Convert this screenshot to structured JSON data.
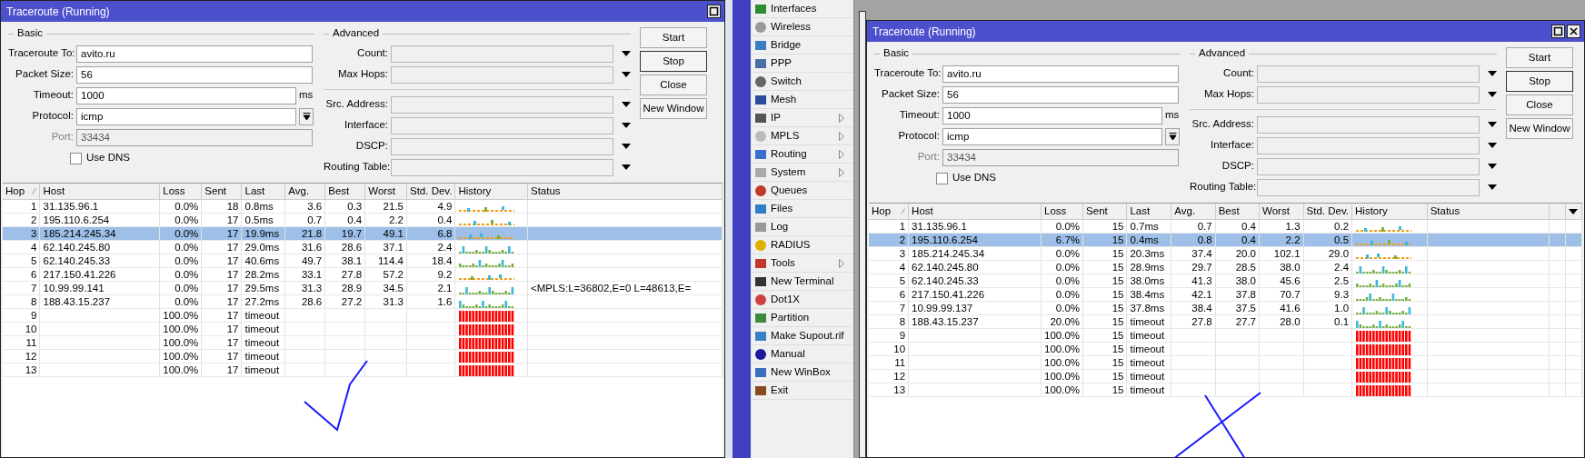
{
  "windows": [
    {
      "title": "Traceroute (Running)",
      "close_button": false,
      "basic_legend": "Basic",
      "advanced_legend": "Advanced",
      "check_mark": true,
      "cross_mark": false,
      "column_menu": false,
      "fields": [
        {
          "label": "Traceroute To:",
          "value": "avito.ru",
          "kind": "text",
          "disabled": false
        },
        {
          "label": "Packet Size:",
          "value": "56",
          "kind": "text",
          "disabled": false
        },
        {
          "label": "Timeout:",
          "value": "1000",
          "unit": "ms",
          "kind": "text",
          "disabled": false
        },
        {
          "label": "Protocol:",
          "value": "icmp",
          "kind": "select",
          "disabled": false
        },
        {
          "label": "Port:",
          "value": "33434",
          "kind": "text",
          "disabled": true
        }
      ],
      "use_dns": {
        "label": "Use DNS",
        "checked": false
      },
      "advanced_fields": [
        {
          "label": "Count:",
          "separator_before": false
        },
        {
          "label": "Max Hops:",
          "separator_before": false
        },
        {
          "label": "Src. Address:",
          "separator_before": true
        },
        {
          "label": "Interface:",
          "separator_before": false
        },
        {
          "label": "DSCP:",
          "separator_before": false
        },
        {
          "label": "Routing Table:",
          "separator_before": false
        }
      ],
      "buttons": [
        {
          "label": "Start",
          "focused": false
        },
        {
          "label": "Stop",
          "focused": true
        },
        {
          "label": "Close",
          "focused": false
        },
        {
          "label": "New Window",
          "focused": false
        }
      ],
      "columns": [
        "Hop",
        "Host",
        "Loss",
        "Sent",
        "Last",
        "Avg.",
        "Best",
        "Worst",
        "Std. Dev.",
        "History",
        "Status"
      ],
      "rows": [
        {
          "hop": "1",
          "host": "31.135.96.1",
          "loss": "0.0%",
          "sent": "18",
          "last": "0.8ms",
          "avg": "3.6",
          "best": "0.3",
          "worst": "21.5",
          "std_dev": "4.9",
          "kind": "dashed",
          "selected": false
        },
        {
          "hop": "2",
          "host": "195.110.6.254",
          "loss": "0.0%",
          "sent": "17",
          "last": "0.5ms",
          "avg": "0.7",
          "best": "0.4",
          "worst": "2.2",
          "std_dev": "0.4",
          "kind": "dashed",
          "selected": false
        },
        {
          "hop": "3",
          "host": "185.214.245.34",
          "loss": "0.0%",
          "sent": "17",
          "last": "19.9ms",
          "avg": "21.8",
          "best": "19.7",
          "worst": "49.1",
          "std_dev": "6.8",
          "kind": "dashed",
          "selected": true
        },
        {
          "hop": "4",
          "host": "62.140.245.80",
          "loss": "0.0%",
          "sent": "17",
          "last": "29.0ms",
          "avg": "31.6",
          "best": "28.6",
          "worst": "37.1",
          "std_dev": "2.4",
          "kind": "bars",
          "selected": false
        },
        {
          "hop": "5",
          "host": "62.140.245.33",
          "loss": "0.0%",
          "sent": "17",
          "last": "40.6ms",
          "avg": "49.7",
          "best": "38.1",
          "worst": "114.4",
          "std_dev": "18.4",
          "kind": "bars",
          "selected": false
        },
        {
          "hop": "6",
          "host": "217.150.41.226",
          "loss": "0.0%",
          "sent": "17",
          "last": "28.2ms",
          "avg": "33.1",
          "best": "27.8",
          "worst": "57.2",
          "std_dev": "9.2",
          "kind": "dashed",
          "selected": false
        },
        {
          "hop": "7",
          "host": "10.99.99.141",
          "loss": "0.0%",
          "sent": "17",
          "last": "29.5ms",
          "avg": "31.3",
          "best": "28.9",
          "worst": "34.5",
          "std_dev": "2.1",
          "kind": "bars",
          "status": "<MPLS:L=36802,E=0 L=48613,E=",
          "selected": false
        },
        {
          "hop": "8",
          "host": "188.43.15.237",
          "loss": "0.0%",
          "sent": "17",
          "last": "27.2ms",
          "avg": "28.6",
          "best": "27.2",
          "worst": "31.3",
          "std_dev": "1.6",
          "kind": "bars",
          "selected": false
        },
        {
          "hop": "9",
          "loss": "100.0%",
          "sent": "17",
          "last": "timeout",
          "kind": "lost",
          "selected": false
        },
        {
          "hop": "10",
          "loss": "100.0%",
          "sent": "17",
          "last": "timeout",
          "kind": "lost",
          "selected": false
        },
        {
          "hop": "11",
          "loss": "100.0%",
          "sent": "17",
          "last": "timeout",
          "kind": "lost",
          "selected": false
        },
        {
          "hop": "12",
          "loss": "100.0%",
          "sent": "17",
          "last": "timeout",
          "kind": "lost",
          "selected": false
        },
        {
          "hop": "13",
          "loss": "100.0%",
          "sent": "17",
          "last": "timeout",
          "kind": "lost",
          "selected": false
        }
      ]
    },
    {
      "title": "Traceroute (Running)",
      "close_button": true,
      "basic_legend": "Basic",
      "advanced_legend": "Advanced",
      "check_mark": false,
      "cross_mark": true,
      "column_menu": true,
      "fields": [
        {
          "label": "Traceroute To:",
          "value": "avito.ru",
          "kind": "text",
          "disabled": false
        },
        {
          "label": "Packet Size:",
          "value": "56",
          "kind": "text",
          "disabled": false
        },
        {
          "label": "Timeout:",
          "value": "1000",
          "unit": "ms",
          "kind": "text",
          "disabled": false
        },
        {
          "label": "Protocol:",
          "value": "icmp",
          "kind": "select",
          "disabled": false
        },
        {
          "label": "Port:",
          "value": "33434",
          "kind": "text",
          "disabled": true
        }
      ],
      "use_dns": {
        "label": "Use DNS",
        "checked": false
      },
      "advanced_fields": [
        {
          "label": "Count:",
          "separator_before": false
        },
        {
          "label": "Max Hops:",
          "separator_before": false
        },
        {
          "label": "Src. Address:",
          "separator_before": true
        },
        {
          "label": "Interface:",
          "separator_before": false
        },
        {
          "label": "DSCP:",
          "separator_before": false
        },
        {
          "label": "Routing Table:",
          "separator_before": false
        }
      ],
      "buttons": [
        {
          "label": "Start",
          "focused": false
        },
        {
          "label": "Stop",
          "focused": true
        },
        {
          "label": "Close",
          "focused": false
        },
        {
          "label": "New Window",
          "focused": false
        }
      ],
      "columns": [
        "Hop",
        "Host",
        "Loss",
        "Sent",
        "Last",
        "Avg.",
        "Best",
        "Worst",
        "Std. Dev.",
        "History",
        "Status"
      ],
      "rows": [
        {
          "hop": "1",
          "host": "31.135.96.1",
          "loss": "0.0%",
          "sent": "15",
          "last": "0.7ms",
          "avg": "0.7",
          "best": "0.4",
          "worst": "1.3",
          "std_dev": "0.2",
          "kind": "dashed",
          "selected": false
        },
        {
          "hop": "2",
          "host": "195.110.6.254",
          "loss": "6.7%",
          "sent": "15",
          "last": "0.4ms",
          "avg": "0.8",
          "best": "0.4",
          "worst": "2.2",
          "std_dev": "0.5",
          "kind": "dashed",
          "selected": true
        },
        {
          "hop": "3",
          "host": "185.214.245.34",
          "loss": "0.0%",
          "sent": "15",
          "last": "20.3ms",
          "avg": "37.4",
          "best": "20.0",
          "worst": "102.1",
          "std_dev": "29.0",
          "kind": "dashed",
          "selected": false
        },
        {
          "hop": "4",
          "host": "62.140.245.80",
          "loss": "0.0%",
          "sent": "15",
          "last": "28.9ms",
          "avg": "29.7",
          "best": "28.5",
          "worst": "38.0",
          "std_dev": "2.4",
          "kind": "bars",
          "selected": false
        },
        {
          "hop": "5",
          "host": "62.140.245.33",
          "loss": "0.0%",
          "sent": "15",
          "last": "38.0ms",
          "avg": "41.3",
          "best": "38.0",
          "worst": "45.6",
          "std_dev": "2.5",
          "kind": "bars",
          "selected": false
        },
        {
          "hop": "6",
          "host": "217.150.41.226",
          "loss": "0.0%",
          "sent": "15",
          "last": "38.4ms",
          "avg": "42.1",
          "best": "37.8",
          "worst": "70.7",
          "std_dev": "9.3",
          "kind": "bars",
          "selected": false
        },
        {
          "hop": "7",
          "host": "10.99.99.137",
          "loss": "0.0%",
          "sent": "15",
          "last": "37.8ms",
          "avg": "38.4",
          "best": "37.5",
          "worst": "41.6",
          "std_dev": "1.0",
          "kind": "bars",
          "selected": false
        },
        {
          "hop": "8",
          "host": "188.43.15.237",
          "loss": "20.0%",
          "sent": "15",
          "last": "timeout",
          "avg": "27.8",
          "best": "27.7",
          "worst": "28.0",
          "std_dev": "0.1",
          "kind": "bars",
          "selected": false
        },
        {
          "hop": "9",
          "loss": "100.0%",
          "sent": "15",
          "last": "timeout",
          "kind": "lost",
          "selected": false
        },
        {
          "hop": "10",
          "loss": "100.0%",
          "sent": "15",
          "last": "timeout",
          "kind": "lost",
          "selected": false
        },
        {
          "hop": "11",
          "loss": "100.0%",
          "sent": "15",
          "last": "timeout",
          "kind": "lost",
          "selected": false
        },
        {
          "hop": "12",
          "loss": "100.0%",
          "sent": "15",
          "last": "timeout",
          "kind": "lost",
          "selected": false
        },
        {
          "hop": "13",
          "loss": "100.0%",
          "sent": "15",
          "last": "timeout",
          "kind": "lost",
          "selected": false
        }
      ]
    }
  ],
  "sidebar": {
    "items": [
      {
        "label": "Interfaces",
        "submenu": false
      },
      {
        "label": "Wireless",
        "submenu": false
      },
      {
        "label": "Bridge",
        "submenu": false
      },
      {
        "label": "PPP",
        "submenu": false
      },
      {
        "label": "Switch",
        "submenu": false
      },
      {
        "label": "Mesh",
        "submenu": false
      },
      {
        "label": "IP",
        "submenu": true
      },
      {
        "label": "MPLS",
        "submenu": true
      },
      {
        "label": "Routing",
        "submenu": true
      },
      {
        "label": "System",
        "submenu": true
      },
      {
        "label": "Queues",
        "submenu": false
      },
      {
        "label": "Files",
        "submenu": false
      },
      {
        "label": "Log",
        "submenu": false
      },
      {
        "label": "RADIUS",
        "submenu": false
      },
      {
        "label": "Tools",
        "submenu": true
      },
      {
        "label": "New Terminal",
        "submenu": false
      },
      {
        "label": "Dot1X",
        "submenu": false
      },
      {
        "label": "Partition",
        "submenu": false
      },
      {
        "label": "Make Supout.rif",
        "submenu": false
      },
      {
        "label": "Manual",
        "submenu": false
      },
      {
        "label": "New WinBox",
        "submenu": false
      },
      {
        "label": "Exit",
        "submenu": false
      }
    ]
  }
}
